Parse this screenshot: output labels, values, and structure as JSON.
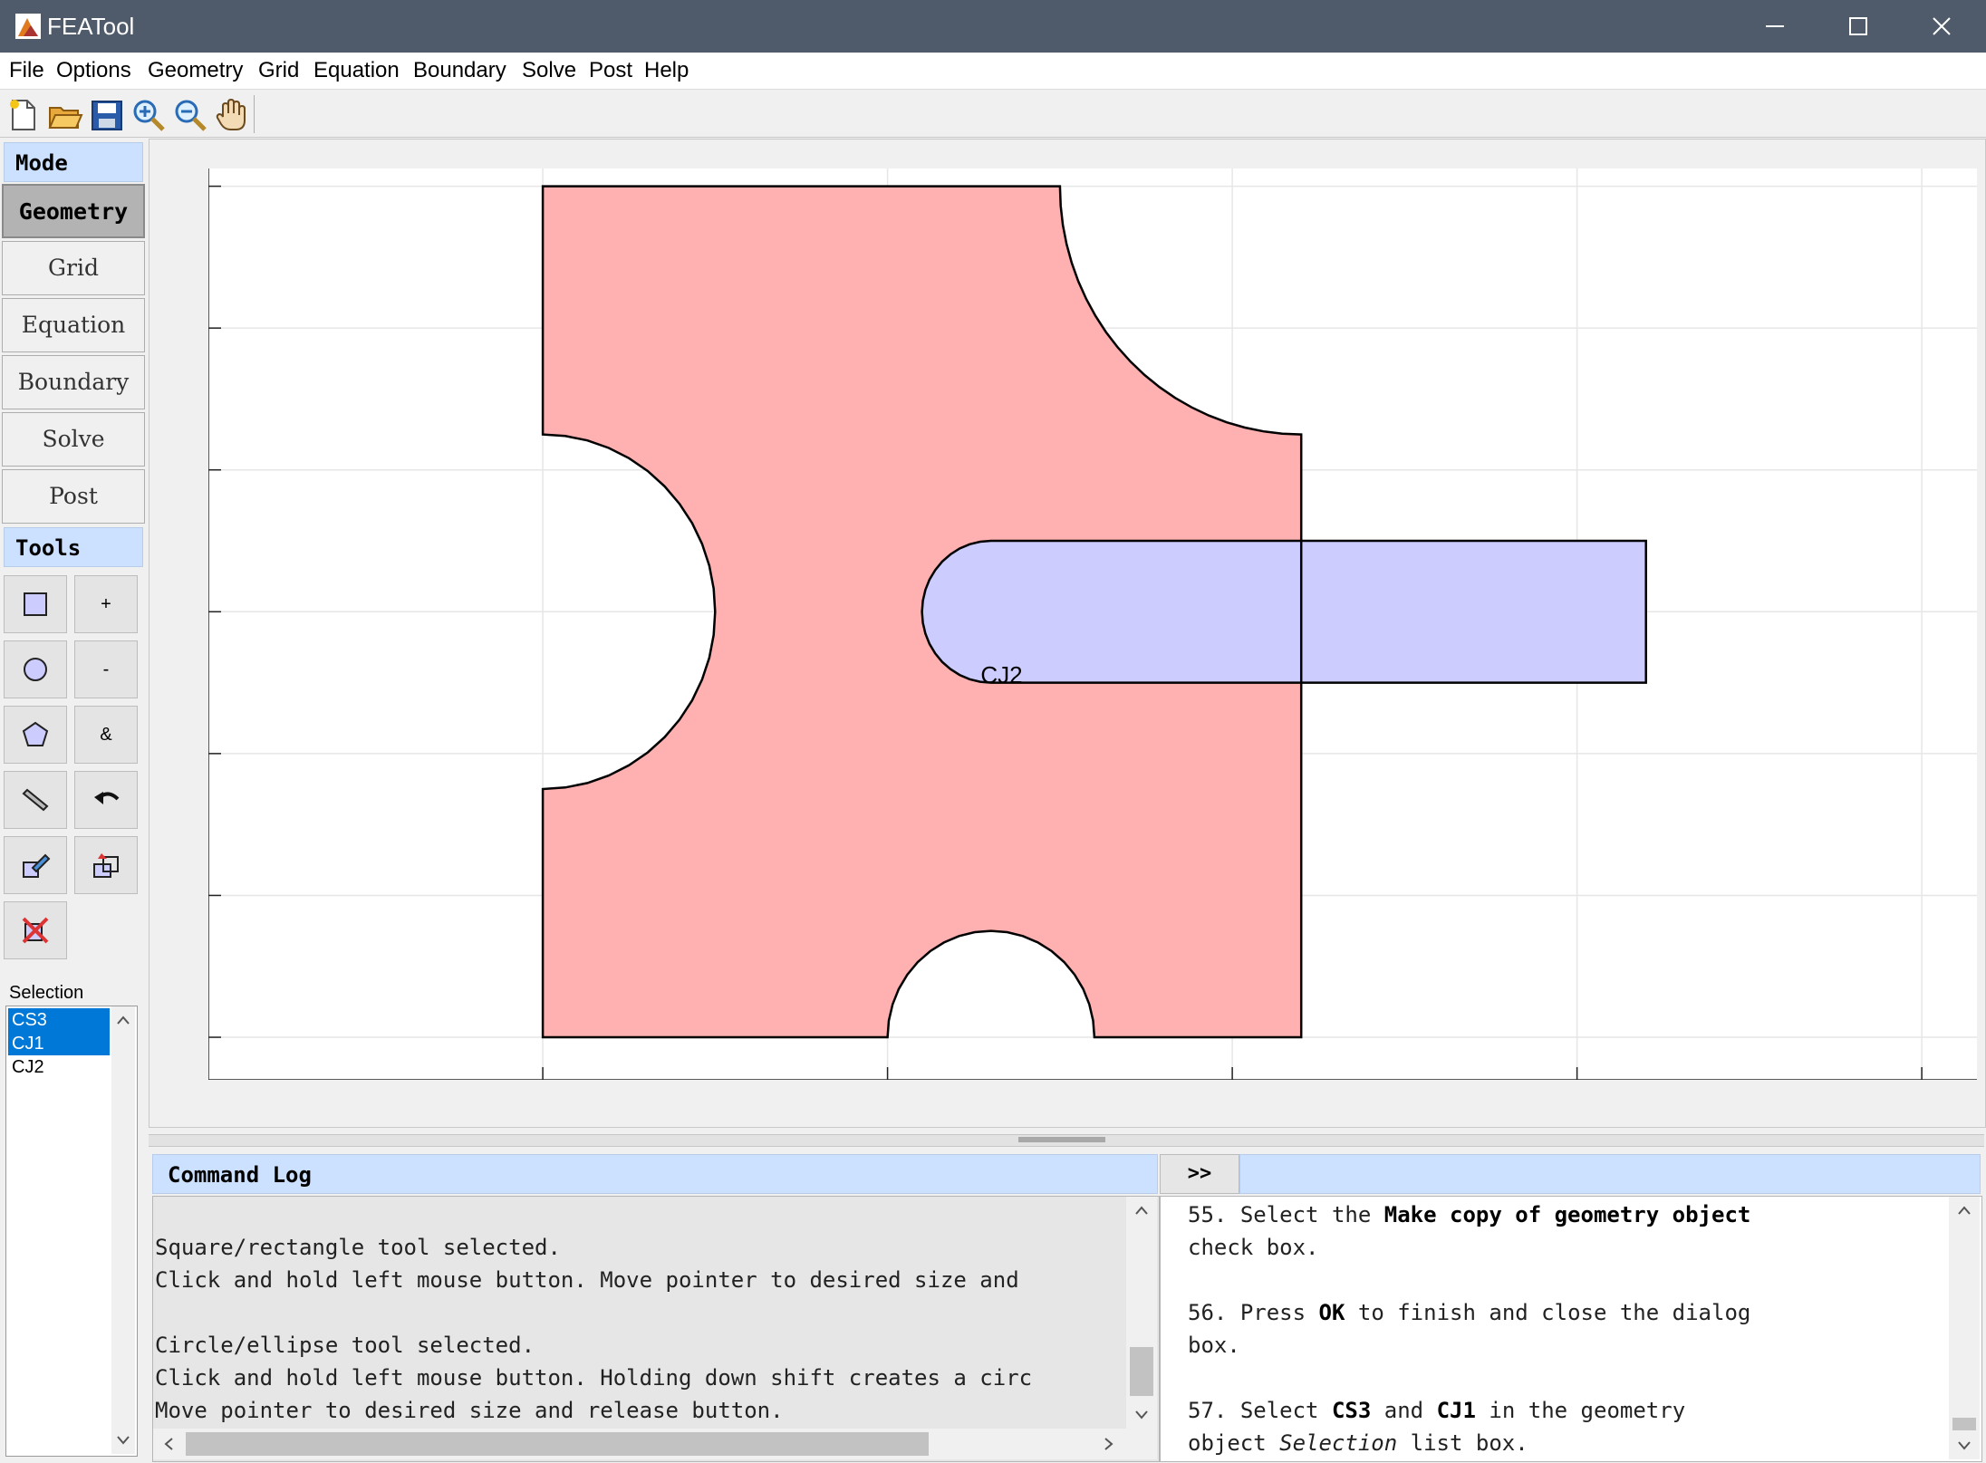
{
  "window": {
    "title": "FEATool"
  },
  "menu": [
    "File",
    "Options",
    "Geometry",
    "Grid",
    "Equation",
    "Boundary",
    "Solve",
    "Post",
    "Help"
  ],
  "toolbar": [
    "new-file-icon",
    "open-folder-icon",
    "save-icon",
    "zoom-in-icon",
    "zoom-out-icon",
    "pan-hand-icon"
  ],
  "sidebar": {
    "mode_header": "Mode",
    "modes": [
      "Geometry",
      "Grid",
      "Equation",
      "Boundary",
      "Solve",
      "Post"
    ],
    "active_mode": "Geometry",
    "tools_header": "Tools",
    "tools": [
      {
        "icon": "rectangle-icon",
        "label": ""
      },
      {
        "icon": "plus-icon",
        "label": "+"
      },
      {
        "icon": "circle-icon",
        "label": ""
      },
      {
        "icon": "minus-icon",
        "label": "-"
      },
      {
        "icon": "polygon-icon",
        "label": ""
      },
      {
        "icon": "intersect-icon",
        "label": "&"
      },
      {
        "icon": "line-icon",
        "label": ""
      },
      {
        "icon": "undo-icon",
        "label": ""
      },
      {
        "icon": "edit-geometry-icon",
        "label": ""
      },
      {
        "icon": "transform-geometry-icon",
        "label": ""
      },
      {
        "icon": "delete-geometry-icon",
        "label": ""
      }
    ],
    "selection_label": "Selection",
    "selection_items": [
      {
        "label": "CS3",
        "selected": true
      },
      {
        "label": "CJ1",
        "selected": true
      },
      {
        "label": "CJ2",
        "selected": false
      }
    ],
    "highlight_color": "#0078d7"
  },
  "plot": {
    "xlim": [
      -0.0485,
      0.208
    ],
    "ylim": [
      -0.006,
      0.1225
    ],
    "xticks": [
      "0",
      "0.05",
      "0.1",
      "0.15",
      "0.2"
    ],
    "xtick_values": [
      0,
      0.05,
      0.1,
      0.15,
      0.2
    ],
    "yticks": [
      "0",
      "0.02",
      "0.04",
      "0.06",
      "0.08",
      "0.1",
      "0.12"
    ],
    "ytick_values": [
      0,
      0.02,
      0.04,
      0.06,
      0.08,
      0.1,
      0.12
    ],
    "grid": true,
    "shapes": [
      {
        "name": "pink-solid",
        "fill": "#ffb0b0",
        "stroke": "#000000"
      },
      {
        "name": "blue-solid",
        "fill": "#ccccff",
        "stroke": "#000000"
      }
    ],
    "label_text": "CJ2",
    "label_pos": [
      0.0635,
      0.0515
    ]
  },
  "command_log": {
    "header": "Command Log",
    "expand_button": ">>",
    "lines": [
      "Square/rectangle tool selected.",
      "Click and hold left mouse button. Move pointer to desired size and",
      "",
      "Circle/ellipse tool selected.",
      "Click and hold left mouse button. Holding down shift creates a circ",
      "Move pointer to desired size and release button."
    ]
  },
  "guide": {
    "step55_num": "55.",
    "step55_a": "Select the",
    "step55_b": "Make copy of geometry object",
    "step55_c": "check box.",
    "step56_num": "56.",
    "step56_a": "Press",
    "step56_b": "OK",
    "step56_c": "to finish and close the dialog",
    "step56_d": "box.",
    "step57_num": "57.",
    "step57_a": "Select",
    "step57_b": "CS3",
    "step57_c": "and",
    "step57_d": "CJ1",
    "step57_e": "in the geometry",
    "step57_f": "object",
    "step57_g": "Selection",
    "step57_h": "list box."
  }
}
